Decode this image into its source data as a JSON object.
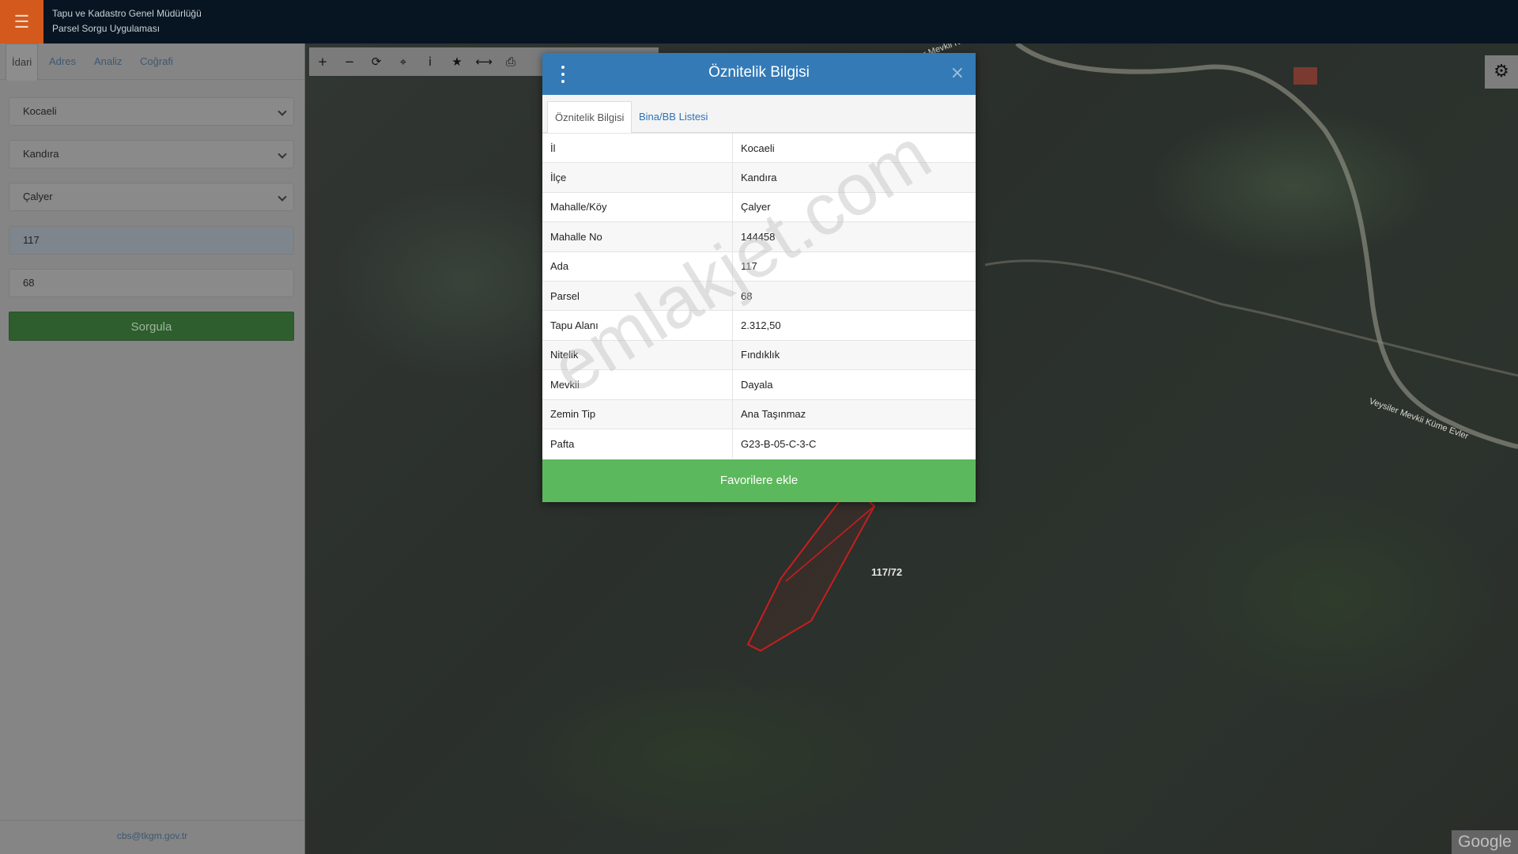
{
  "header": {
    "menu_icon": "hamburger-icon",
    "title_line1": "Tapu ve Kadastro Genel Müdürlüğü",
    "title_line2": "Parsel Sorgu Uygulaması"
  },
  "sidebar": {
    "tabs": [
      {
        "label": "İdari",
        "active": true
      },
      {
        "label": "Adres"
      },
      {
        "label": "Analiz"
      },
      {
        "label": "Coğrafi"
      }
    ],
    "fields": {
      "il": "Kocaeli",
      "ilce": "Kandıra",
      "mahalle": "Çalyer",
      "ada": "117",
      "parsel": "68"
    },
    "query_button": "Sorgula",
    "query_button_color": "#2e5d2e",
    "footer_email": "cbs@tkgm.gov.tr"
  },
  "map": {
    "toolbar": [
      "plus-icon",
      "minus-icon",
      "refresh-icon",
      "crosshair-icon",
      "info-icon",
      "star-icon",
      "measure-icon",
      "print-icon"
    ],
    "settings_icon": "gear-icon",
    "parcel_label": "117/72",
    "road_labels": [
      "Çalyer Harsolar Mevkii Küme Evler",
      "Veysiler Mevkii Küme Evler"
    ],
    "attribution": "Google"
  },
  "modal": {
    "title": "Öznitelik Bilgisi",
    "header_color": "#337ab7",
    "tabs": [
      "Öznitelik Bilgisi",
      "Bina/BB Listesi"
    ],
    "rows": [
      {
        "key": "İl",
        "value": "Kocaeli"
      },
      {
        "key": "İlçe",
        "value": "Kandıra"
      },
      {
        "key": "Mahalle/Köy",
        "value": "Çalyer"
      },
      {
        "key": "Mahalle No",
        "value": "144458"
      },
      {
        "key": "Ada",
        "value": "117"
      },
      {
        "key": "Parsel",
        "value": "68"
      },
      {
        "key": "Tapu Alanı",
        "value": "2.312,50"
      },
      {
        "key": "Nitelik",
        "value": "Fındıklık"
      },
      {
        "key": "Mevkii",
        "value": "Dayala"
      },
      {
        "key": "Zemin Tip",
        "value": "Ana Taşınmaz"
      },
      {
        "key": "Pafta",
        "value": "G23-B-05-C-3-C"
      }
    ],
    "favorite_button": "Favorilere ekle",
    "favorite_color": "#5cb85c"
  },
  "watermark": "emlakjet.com"
}
